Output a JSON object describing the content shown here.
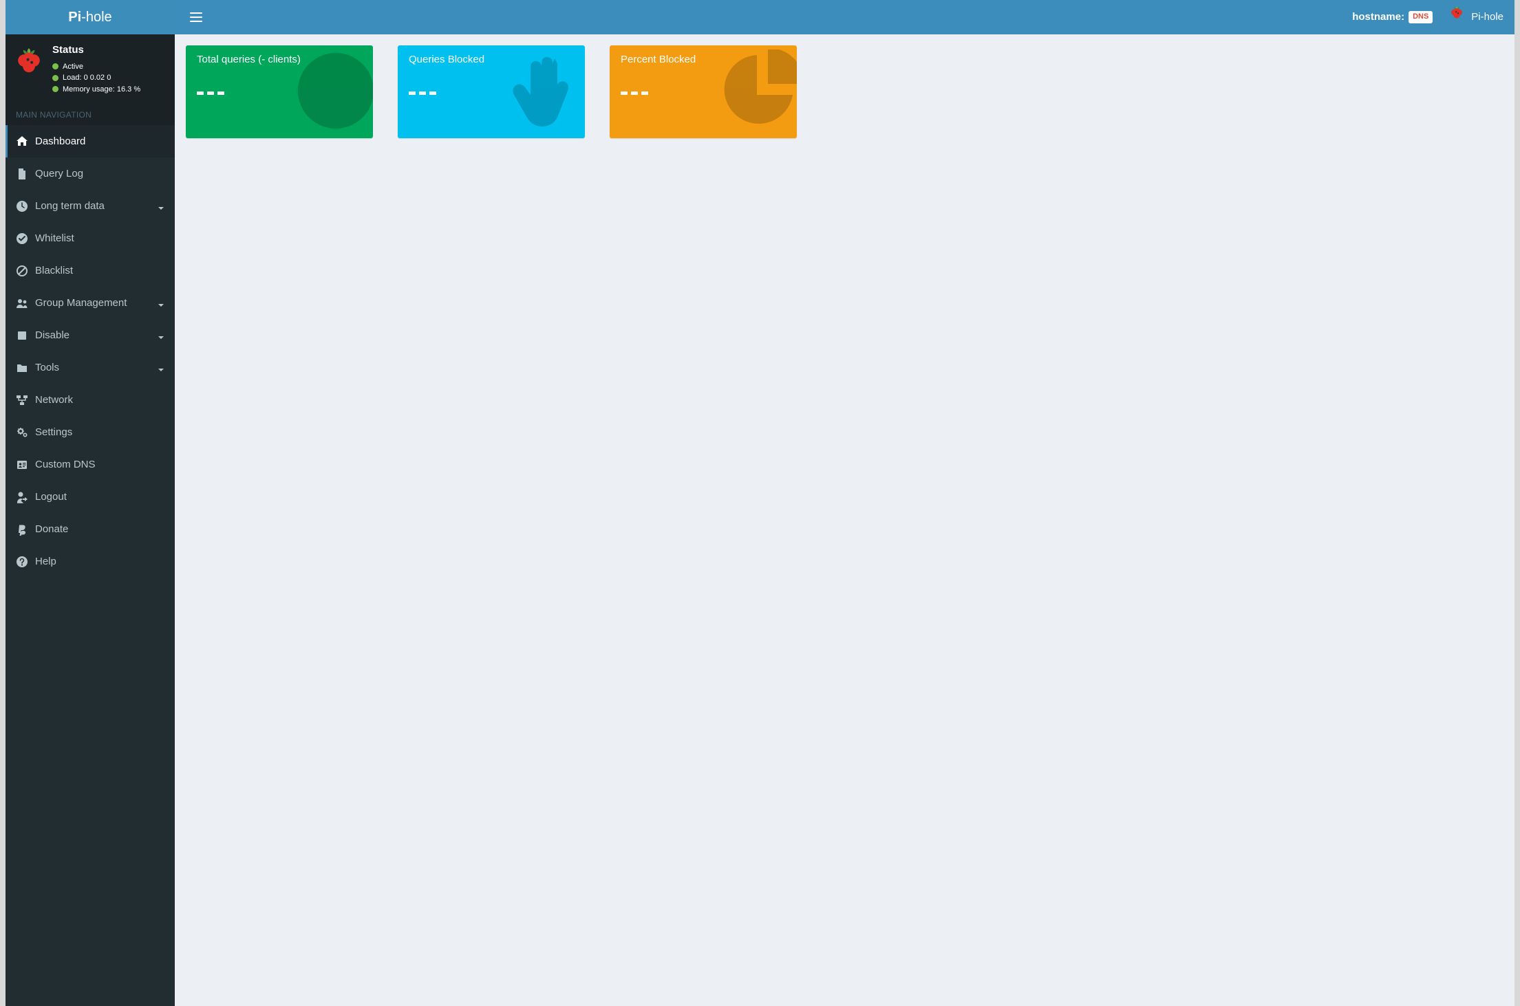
{
  "header": {
    "logo_bold": "Pi",
    "logo_rest": "-hole",
    "hostname_label": "hostname:",
    "dns_badge": "DNS",
    "brand": "Pi-hole"
  },
  "sidebar": {
    "status_title": "Status",
    "status_lines": {
      "active": "Active",
      "load": "Load:  0  0.02  0",
      "memory": "Memory usage:  16.3 %"
    },
    "section_header": "MAIN NAVIGATION",
    "items": [
      {
        "label": "Dashboard",
        "icon": "home",
        "expandable": false,
        "active": true
      },
      {
        "label": "Query Log",
        "icon": "file",
        "expandable": false,
        "active": false
      },
      {
        "label": "Long term data",
        "icon": "clock",
        "expandable": true,
        "active": false
      },
      {
        "label": "Whitelist",
        "icon": "check",
        "expandable": false,
        "active": false
      },
      {
        "label": "Blacklist",
        "icon": "ban",
        "expandable": false,
        "active": false
      },
      {
        "label": "Group Management",
        "icon": "users",
        "expandable": true,
        "active": false
      },
      {
        "label": "Disable",
        "icon": "stop",
        "expandable": true,
        "active": false
      },
      {
        "label": "Tools",
        "icon": "folder",
        "expandable": true,
        "active": false
      },
      {
        "label": "Network",
        "icon": "network",
        "expandable": false,
        "active": false
      },
      {
        "label": "Settings",
        "icon": "cogs",
        "expandable": false,
        "active": false
      },
      {
        "label": "Custom DNS",
        "icon": "address",
        "expandable": false,
        "active": false
      },
      {
        "label": "Logout",
        "icon": "logout",
        "expandable": false,
        "active": false
      },
      {
        "label": "Donate",
        "icon": "paypal",
        "expandable": false,
        "active": false
      },
      {
        "label": "Help",
        "icon": "question",
        "expandable": false,
        "active": false
      }
    ]
  },
  "stats": [
    {
      "title": "Total queries (- clients)",
      "value_display": "---",
      "color": "green",
      "bg_icon": "globe"
    },
    {
      "title": "Queries Blocked",
      "value_display": "---",
      "color": "blue",
      "bg_icon": "hand"
    },
    {
      "title": "Percent Blocked",
      "value_display": "---",
      "color": "orange",
      "bg_icon": "pie"
    }
  ],
  "colors": {
    "header": "#3c8dbc",
    "logo": "#3d8dbb",
    "sidebar": "#222d32",
    "green": "#00a65a",
    "blue": "#00c0ef",
    "orange": "#f39c12"
  }
}
